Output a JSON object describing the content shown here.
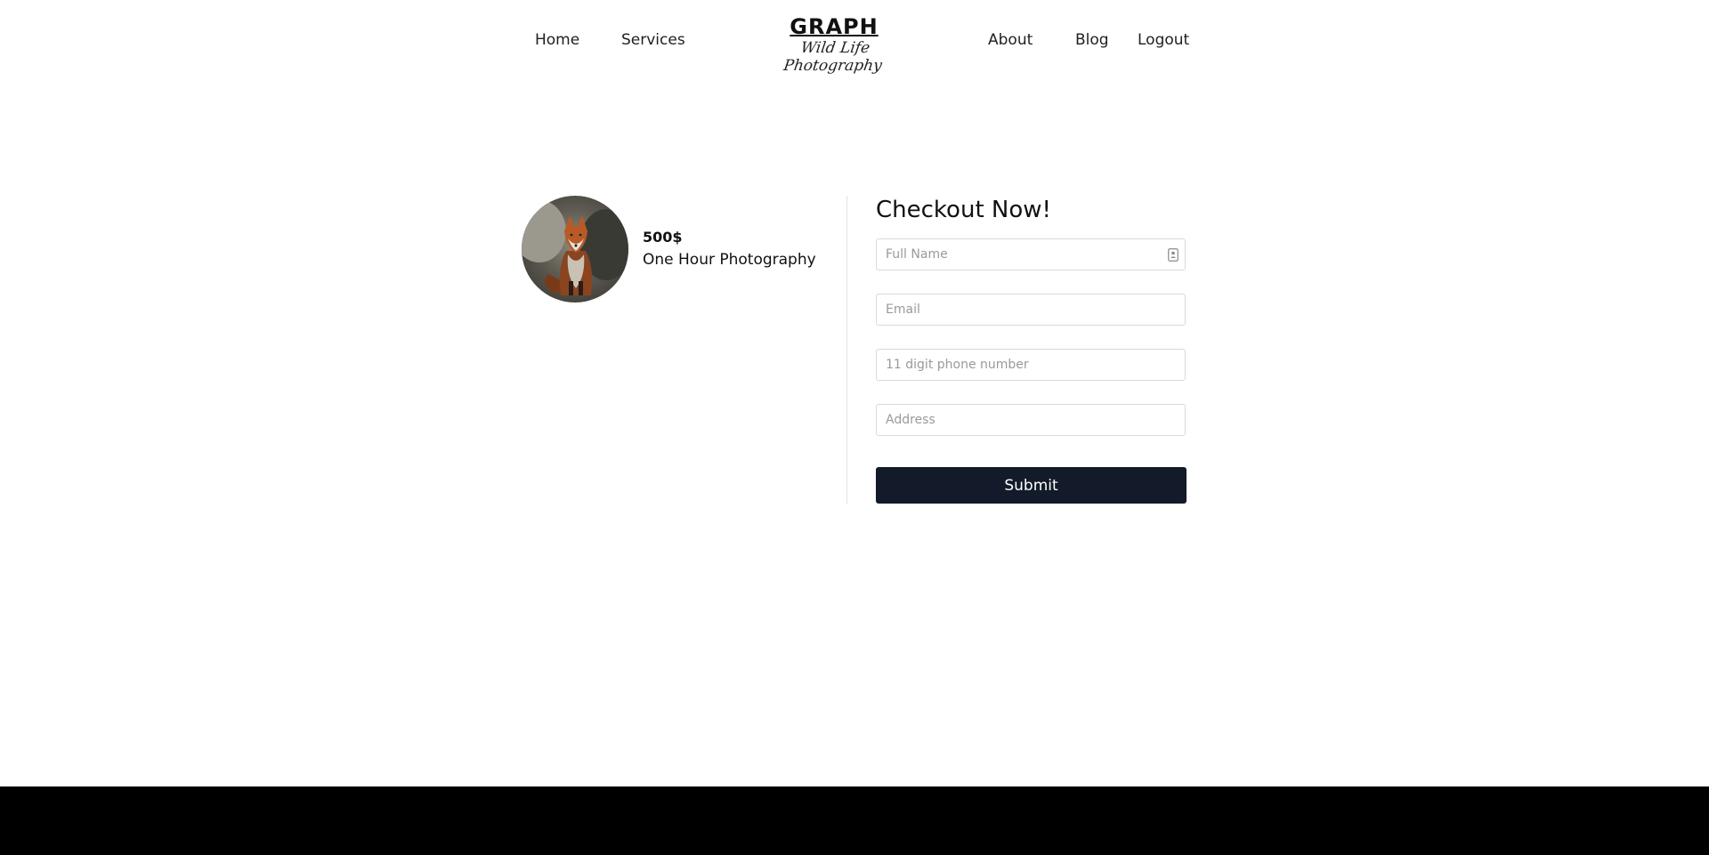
{
  "nav": {
    "home": "Home",
    "services": "Services",
    "about": "About",
    "blog": "Blog",
    "logout": "Logout"
  },
  "brand": {
    "title": "GRAPH",
    "tagline": "Wild Life Photography"
  },
  "product": {
    "price": "500$",
    "name": "One Hour Photography",
    "image_icon": "fox-photo"
  },
  "checkout": {
    "title": "Checkout Now!",
    "full_name_placeholder": "Full Name",
    "email_placeholder": "Email",
    "phone_placeholder": "11 digit phone number",
    "address_placeholder": "Address",
    "submit_label": "Submit"
  },
  "colors": {
    "submit_bg": "#131b2a",
    "footer_bg": "#000000"
  }
}
